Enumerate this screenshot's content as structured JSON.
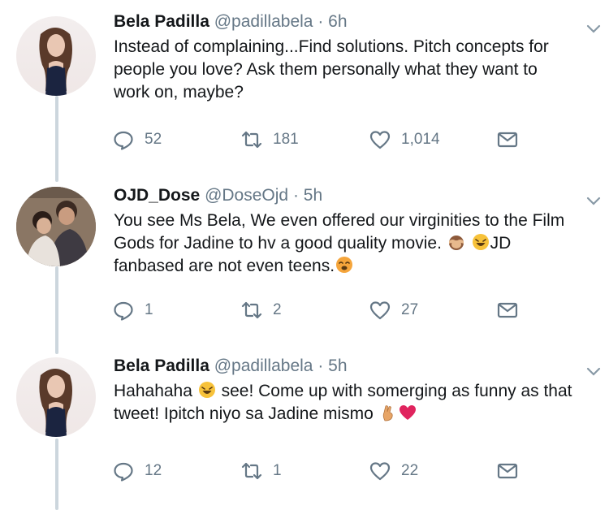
{
  "tweets": [
    {
      "name": "Bela Padilla",
      "handle": "@padillabela",
      "separator": "·",
      "time": "6h",
      "text": "Instead of complaining...Find solutions. Pitch concepts for people you love? Ask them personally what they want to work on, maybe?",
      "replies": "52",
      "retweets": "181",
      "likes": "1,014"
    },
    {
      "name": "OJD_Dose",
      "handle": "@DoseOjd",
      "separator": "·",
      "time": "5h",
      "text_part1": "You see Ms Bela, We even offered our virginities to the Film Gods for Jadine to hv a good quality movie.",
      "text_part2": "JD fanbased are not even teens.",
      "replies": "1",
      "retweets": "2",
      "likes": "27"
    },
    {
      "name": "Bela Padilla",
      "handle": "@padillabela",
      "separator": "·",
      "time": "5h",
      "text_part1": "Hahahaha",
      "text_part2": "see! Come up with somerging as funny as that tweet! Ipitch niyo sa Jadine mismo",
      "replies": "12",
      "retweets": "1",
      "likes": "22"
    }
  ],
  "icons": {
    "reply": "reply-icon",
    "retweet": "retweet-icon",
    "like": "heart-icon",
    "dm": "envelope-icon",
    "caret": "chevron-down-icon"
  },
  "colors": {
    "text": "#14171a",
    "secondary": "#657786",
    "thread_line": "#ccd6dd"
  }
}
